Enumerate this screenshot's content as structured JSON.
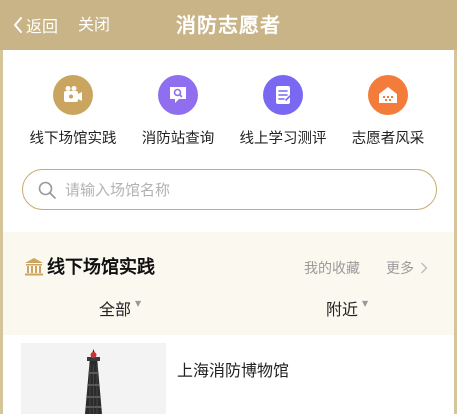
{
  "header": {
    "back_label": "返回",
    "close_label": "关闭",
    "title": "消防志愿者"
  },
  "entries": [
    {
      "label": "线下场馆实践",
      "icon": "camera-icon",
      "color": "#c9a55f"
    },
    {
      "label": "消防站查询",
      "icon": "search-chat-icon",
      "color": "#8f6ff0"
    },
    {
      "label": "线上学习测评",
      "icon": "checklist-icon",
      "color": "#7a68f2"
    },
    {
      "label": "志愿者风采",
      "icon": "house-icon",
      "color": "#f47c3a"
    }
  ],
  "search": {
    "placeholder": "请输入场馆名称"
  },
  "section": {
    "title": "线下场馆实践",
    "favorites_label": "我的收藏",
    "more_label": "更多",
    "filters": [
      "全部",
      "附近"
    ]
  },
  "venues": [
    {
      "name": "上海消防博物馆"
    }
  ],
  "colors": {
    "header_bg": "#c9b487",
    "section_bg": "#fbf8f0",
    "search_border": "#c9ab70"
  }
}
